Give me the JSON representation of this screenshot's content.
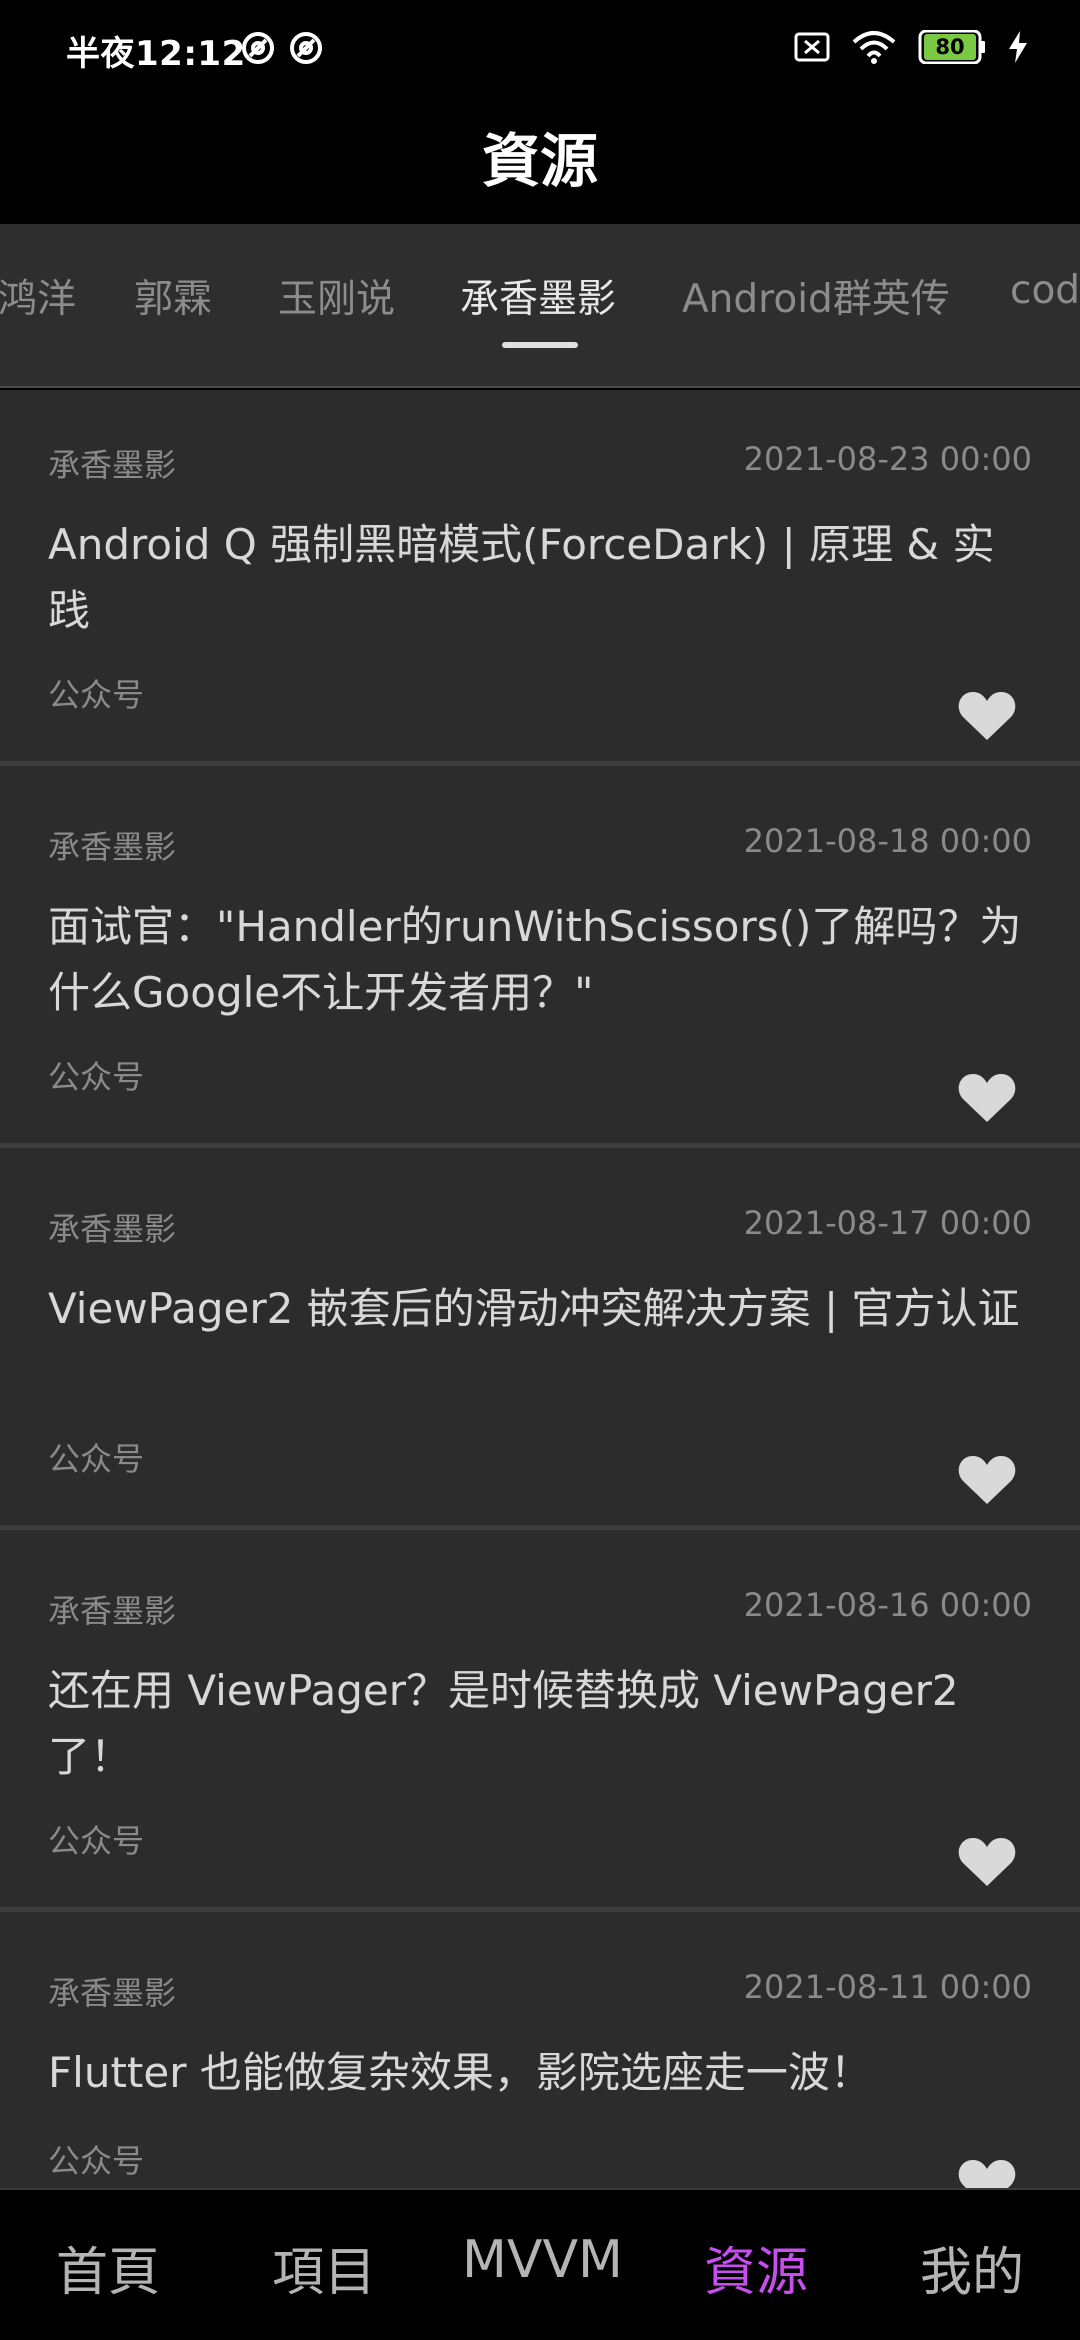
{
  "status_bar": {
    "time": "半夜12:12",
    "battery": "80",
    "icons": [
      "at-circle-icon",
      "at-circle-icon",
      "sim-off-icon",
      "wifi-icon",
      "battery-icon",
      "charging-bolt-icon"
    ]
  },
  "header": {
    "title": "資源"
  },
  "tabs": [
    {
      "label": "鸿洋",
      "active": false
    },
    {
      "label": "郭霖",
      "active": false
    },
    {
      "label": "玉刚说",
      "active": false
    },
    {
      "label": "承香墨影",
      "active": true
    },
    {
      "label": "Android群英传",
      "active": false
    },
    {
      "label": "code",
      "active": false
    }
  ],
  "articles": [
    {
      "author": "承香墨影",
      "date": "2021-08-23 00:00",
      "title": "Android Q 强制黑暗模式(ForceDark) | 原理 & 实践",
      "source": "公众号",
      "liked": true
    },
    {
      "author": "承香墨影",
      "date": "2021-08-18 00:00",
      "title": "面试官：\"Handler的runWithScissors()了解吗？为什么Google不让开发者用？\"",
      "source": "公众号",
      "liked": true
    },
    {
      "author": "承香墨影",
      "date": "2021-08-17 00:00",
      "title": "ViewPager2 嵌套后的滑动冲突解决方案 | 官方认证",
      "source": "公众号",
      "liked": true
    },
    {
      "author": "承香墨影",
      "date": "2021-08-16 00:00",
      "title": "还在用 ViewPager？是时候替换成 ViewPager2 了！",
      "source": "公众号",
      "liked": true
    },
    {
      "author": "承香墨影",
      "date": "2021-08-11 00:00",
      "title": "Flutter 也能做复杂效果，影院选座走一波！",
      "source": "公众号",
      "liked": true
    }
  ],
  "bottom_nav": [
    {
      "label": "首頁",
      "active": false
    },
    {
      "label": "項目",
      "active": false
    },
    {
      "label": "MVVM",
      "active": false
    },
    {
      "label": "資源",
      "active": true
    },
    {
      "label": "我的",
      "active": false
    }
  ],
  "colors": {
    "background": "#000000",
    "card_background": "#2c2c2c",
    "accent": "#c84ef0",
    "heart": "#d9d9d9"
  }
}
